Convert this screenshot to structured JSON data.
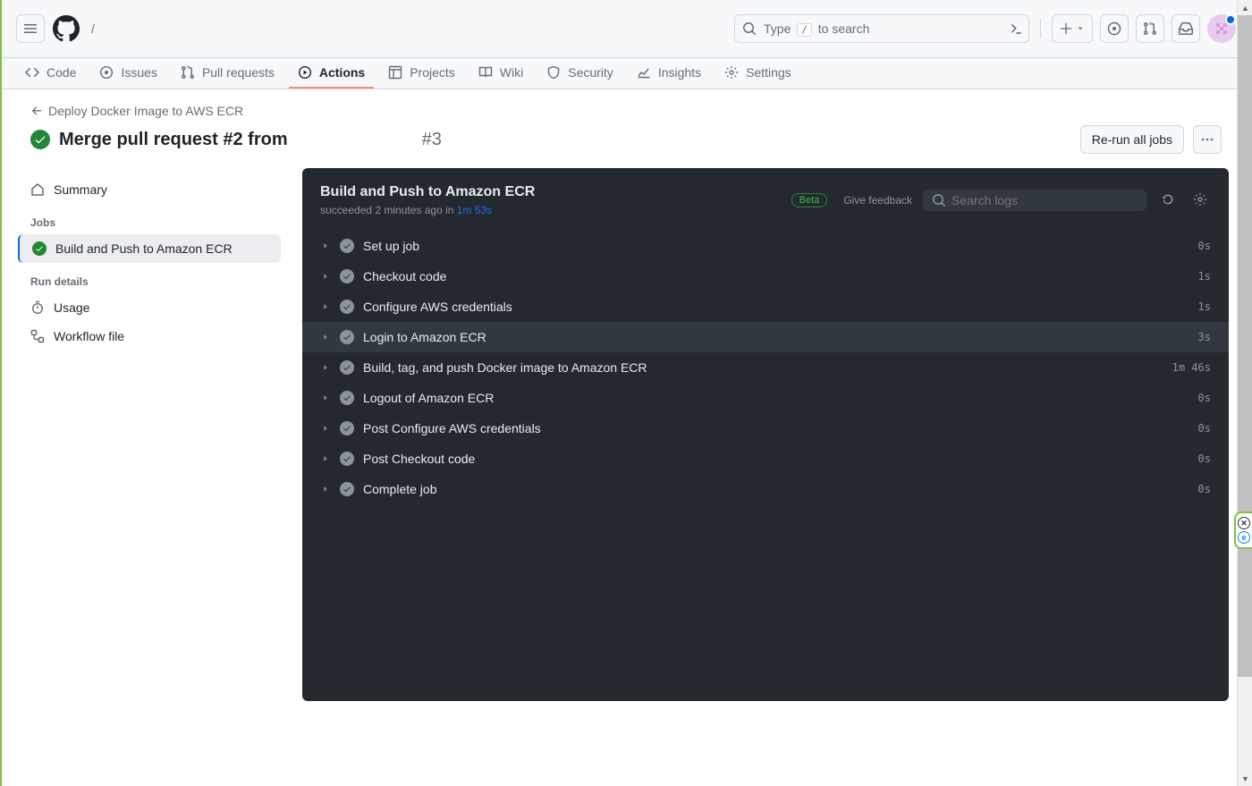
{
  "header": {
    "breadcrumb_sep": "/",
    "search": {
      "placeholder": "Type / to search",
      "prefix": "Type ",
      "slash": "/",
      "suffix": " to search"
    }
  },
  "nav": {
    "items": [
      {
        "label": "Code"
      },
      {
        "label": "Issues"
      },
      {
        "label": "Pull requests"
      },
      {
        "label": "Actions",
        "active": true
      },
      {
        "label": "Projects"
      },
      {
        "label": "Wiki"
      },
      {
        "label": "Security"
      },
      {
        "label": "Insights"
      },
      {
        "label": "Settings"
      }
    ]
  },
  "page": {
    "back_label": "Deploy Docker Image to AWS ECR",
    "title": "Merge pull request #2 from",
    "run_number": "#3",
    "rerun_label": "Re-run all jobs"
  },
  "sidebar": {
    "summary_label": "Summary",
    "jobs_heading": "Jobs",
    "job_label": "Build and Push to Amazon ECR",
    "details_heading": "Run details",
    "usage_label": "Usage",
    "workflow_file_label": "Workflow file"
  },
  "job": {
    "title": "Build and Push to Amazon ECR",
    "status_prefix": "succeeded ",
    "status_time": "2 minutes ago",
    "status_in": " in ",
    "duration": "1m 53s",
    "beta_label": "Beta",
    "feedback_label": "Give feedback",
    "search_placeholder": "Search logs",
    "steps": [
      {
        "name": "Set up job",
        "duration": "0s"
      },
      {
        "name": "Checkout code",
        "duration": "1s"
      },
      {
        "name": "Configure AWS credentials",
        "duration": "1s"
      },
      {
        "name": "Login to Amazon ECR",
        "duration": "3s",
        "hover": true
      },
      {
        "name": "Build, tag, and push Docker image to Amazon ECR",
        "duration": "1m 46s"
      },
      {
        "name": "Logout of Amazon ECR",
        "duration": "0s"
      },
      {
        "name": "Post Configure AWS credentials",
        "duration": "0s"
      },
      {
        "name": "Post Checkout code",
        "duration": "0s"
      },
      {
        "name": "Complete job",
        "duration": "0s"
      }
    ]
  }
}
